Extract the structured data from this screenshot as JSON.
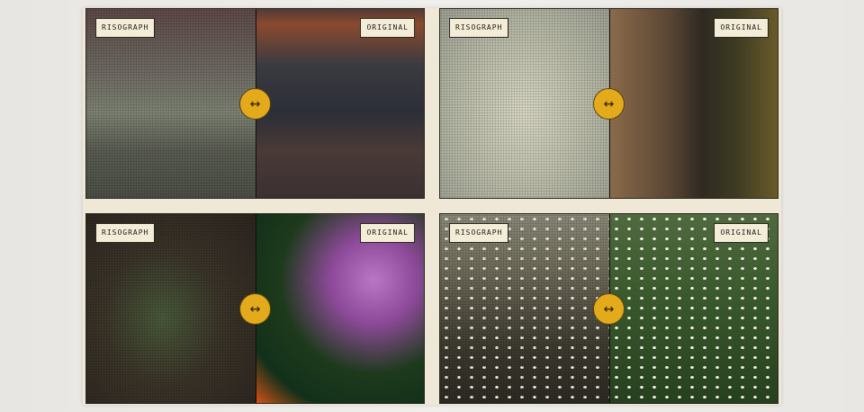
{
  "cards": [
    {
      "id": "ocean",
      "left_label": "RISOGRAPH",
      "right_label": "ORIGINAL",
      "handle_icon": "↔"
    },
    {
      "id": "wolf",
      "left_label": "RISOGRAPH",
      "right_label": "ORIGINAL",
      "handle_icon": "↔"
    },
    {
      "id": "flower",
      "left_label": "RISOGRAPH",
      "right_label": "ORIGINAL",
      "handle_icon": "↔"
    },
    {
      "id": "daisy",
      "left_label": "RISOGRAPH",
      "right_label": "ORIGINAL",
      "handle_icon": "↔"
    }
  ],
  "colors": {
    "handle": "#e3ab1c",
    "tag_bg": "#f3ecd7",
    "panel_bg": "#efe8d6"
  },
  "icons": {
    "handle": "arrows-horizontal-icon"
  }
}
